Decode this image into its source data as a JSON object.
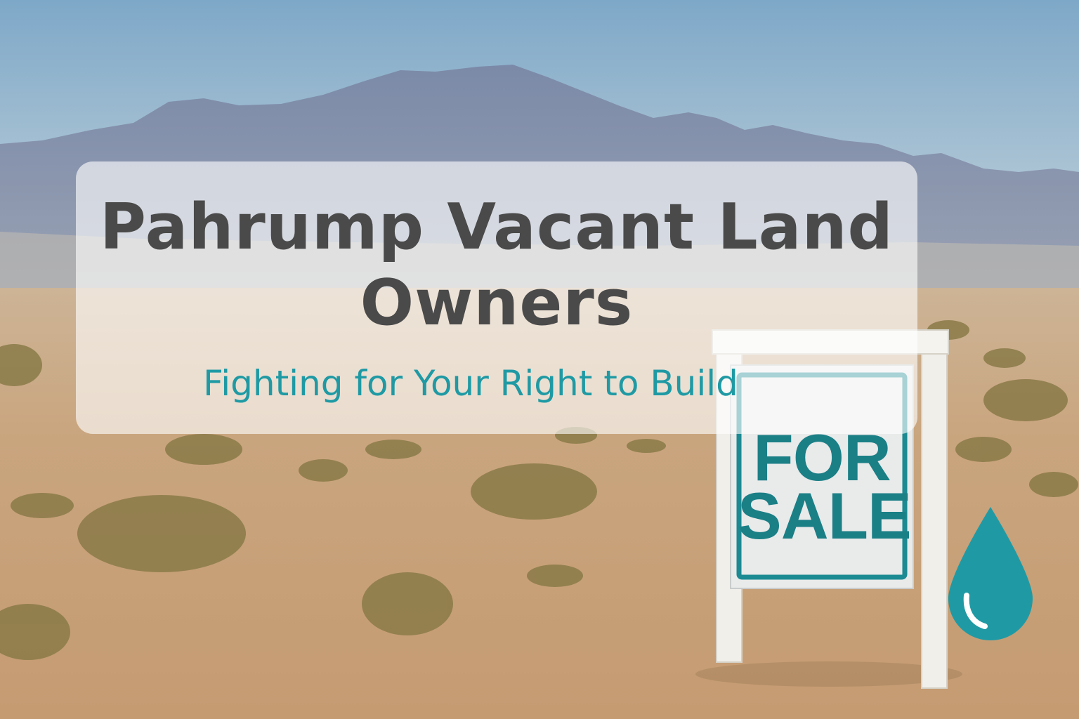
{
  "banner": {
    "title_line_1": "Pahrump Vacant Land",
    "title_line_2": "Owners",
    "subtitle": "Fighting for Your Right to Build"
  },
  "sign": {
    "line_1": "FOR",
    "line_2": "SALE"
  },
  "colors": {
    "title": "#4a4a4a",
    "accent_teal": "#1f9aa4",
    "sign_text": "#1b7f86",
    "sky_top": "#7fa9c9",
    "ground": "#c9a57e"
  },
  "icons": {
    "water_drop": "water-drop-icon"
  }
}
